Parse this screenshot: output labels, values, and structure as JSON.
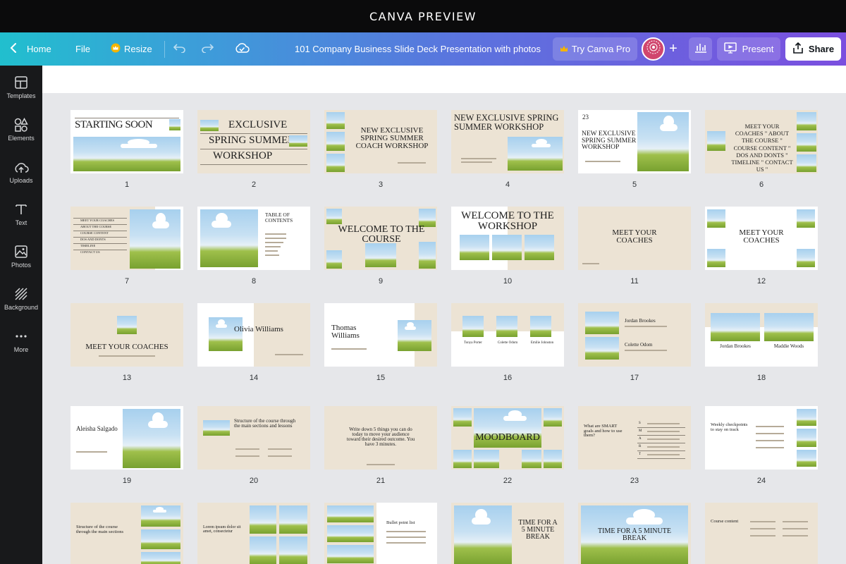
{
  "header": {
    "title": "CANVA PREVIEW"
  },
  "toolbar": {
    "home": "Home",
    "file": "File",
    "resize": "Resize",
    "doc_title": "101 Company Business Slide Deck Presentation with photos",
    "try_pro": "Try Canva Pro",
    "present": "Present",
    "share": "Share"
  },
  "sidebar": {
    "items": [
      {
        "label": "Templates",
        "icon": "templates-icon"
      },
      {
        "label": "Elements",
        "icon": "elements-icon"
      },
      {
        "label": "Uploads",
        "icon": "uploads-icon"
      },
      {
        "label": "Text",
        "icon": "text-icon"
      },
      {
        "label": "Photos",
        "icon": "photos-icon"
      },
      {
        "label": "Background",
        "icon": "background-icon"
      },
      {
        "label": "More",
        "icon": "more-icon"
      }
    ]
  },
  "slides": {
    "s1": {
      "n": "1",
      "t": "STARTING SOON"
    },
    "s2": {
      "n": "2",
      "t1": "EXCLUSIVE",
      "t2": "SPRING SUMMER",
      "t3": "WORKSHOP"
    },
    "s3": {
      "n": "3",
      "t": "NEW EXCLUSIVE SPRING SUMMER COACH WORKSHOP"
    },
    "s4": {
      "n": "4",
      "t": "NEW EXCLUSIVE SPRING SUMMER WORKSHOP"
    },
    "s5": {
      "n": "5",
      "num": "23",
      "t": "NEW EXCLUSIVE SPRING SUMMER WORKSHOP"
    },
    "s6": {
      "n": "6",
      "t": "MEET YOUR COACHES \" ABOUT THE COURSE \" COURSE CONTENT \" DOS AND DONTS \" TIMELINE \" CONTACT US \""
    },
    "s7": {
      "n": "7",
      "items": [
        "MEET YOUR COACHES",
        "ABOUT THE COURSE",
        "COURSE CONTENT",
        "DOS AND DONTS",
        "TIMELINE",
        "CONTACT US"
      ]
    },
    "s8": {
      "n": "8",
      "t": "TABLE OF CONTENTS"
    },
    "s9": {
      "n": "9",
      "t": "WELCOME TO THE COURSE"
    },
    "s10": {
      "n": "10",
      "t": "WELCOME TO THE WORKSHOP"
    },
    "s11": {
      "n": "11",
      "t": "MEET YOUR COACHES"
    },
    "s12": {
      "n": "12",
      "t": "MEET YOUR COACHES"
    },
    "s13": {
      "n": "13",
      "t": "MEET YOUR COACHES"
    },
    "s14": {
      "n": "14",
      "t": "Olivia Williams"
    },
    "s15": {
      "n": "15",
      "t": "Thomas Williams"
    },
    "s16": {
      "n": "16",
      "a": "Tonya Porter",
      "b": "Colette Odom",
      "c": "Emilie Johnston"
    },
    "s17": {
      "n": "17",
      "a": "Jordan Brookes",
      "b": "Colette Odom"
    },
    "s18": {
      "n": "18",
      "a": "Jordan Brookes",
      "b": "Maddie Woods"
    },
    "s19": {
      "n": "19",
      "t": "Aleisha Salgado"
    },
    "s20": {
      "n": "20",
      "t": "Structure of the course through the main sections and lessons"
    },
    "s21": {
      "n": "21",
      "t": "Write down 5 things you can do today to move your audience toward their desired outcome. You have 3 minutes."
    },
    "s22": {
      "n": "22",
      "t": "MOODBOARD"
    },
    "s23": {
      "n": "23",
      "t": "What are SMART goals and how to use them?",
      "letters": [
        "S",
        "M",
        "A",
        "R",
        "T"
      ]
    },
    "s24": {
      "n": "24",
      "t": "Weekly checkpoints to stay on track"
    },
    "s25": {
      "t": "Structure of the course through the main sections"
    },
    "s26": {
      "t": "Lorem ipsum dolor sit amet, consectetur"
    },
    "s27": {
      "t": "Bullet point list"
    },
    "s28": {
      "t": "TIME FOR A 5 MINUTE BREAK"
    },
    "s29": {
      "t": "TIME FOR A 5 MINUTE BREAK"
    },
    "s30": {
      "t": "Course content"
    }
  }
}
